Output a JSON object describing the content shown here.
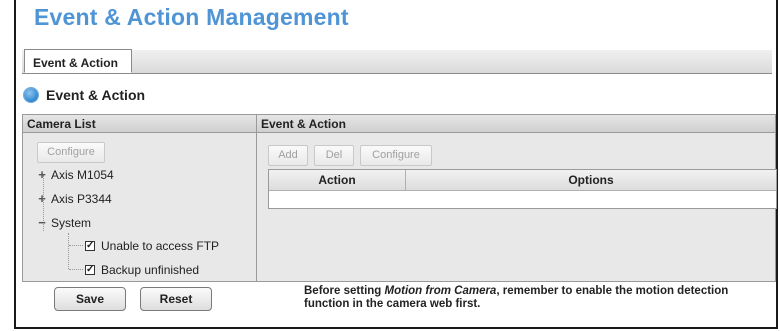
{
  "header": {
    "title": "Event & Action Management"
  },
  "tabs": [
    {
      "label": "Event & Action",
      "active": true
    }
  ],
  "section": {
    "title": "Event & Action",
    "bullet_color": "#2f86cf"
  },
  "camera_list": {
    "header": "Camera List",
    "configure_label": "Configure",
    "tree": [
      {
        "label": "Axis M1054",
        "expander": "+"
      },
      {
        "label": "Axis P3344",
        "expander": "+"
      },
      {
        "label": "System",
        "expander": "−",
        "children": [
          {
            "label": "Unable to access FTP",
            "checked": true,
            "mark": "✓"
          },
          {
            "label": "Backup unfinished",
            "checked": true,
            "mark": "✓"
          }
        ]
      }
    ]
  },
  "event_action": {
    "header": "Event & Action",
    "buttons": {
      "add": "Add",
      "del": "Del",
      "configure": "Configure"
    },
    "columns": [
      "Action",
      "Options"
    ]
  },
  "footer": {
    "save": "Save",
    "reset": "Reset",
    "note_before": "Before setting ",
    "note_em": "Motion from Camera",
    "note_after": ", remember to enable the motion detection function in the camera web first."
  },
  "colors": {
    "title": "#4f95d6",
    "panel_bg": "#e8e8e8"
  }
}
